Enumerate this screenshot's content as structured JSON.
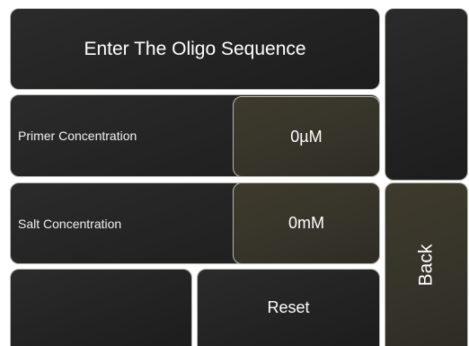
{
  "header": {
    "title": "Enter The Oligo Sequence"
  },
  "primer": {
    "label": "Primer Concentration",
    "value": "0µM"
  },
  "salt": {
    "label": "Salt Concentration",
    "value": "0mM"
  },
  "actions": {
    "reset_label": "Reset",
    "back_label": "Back"
  },
  "colors": {
    "panel": "#232323",
    "value_panel": "#36332a",
    "border": "#b8b8b0",
    "text": "#ffffff"
  }
}
